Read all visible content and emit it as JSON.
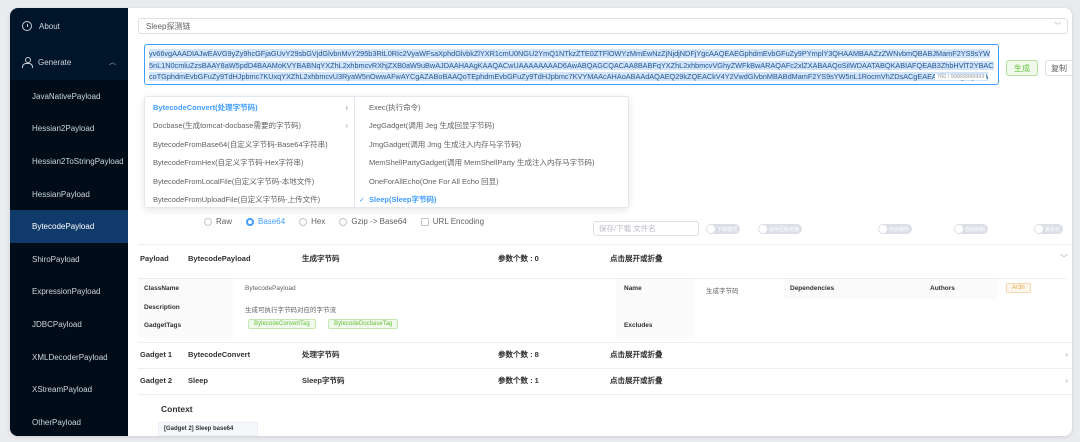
{
  "sidebar": {
    "about": "About",
    "generate": "Generate",
    "items": [
      {
        "label": "JavaNativePayload"
      },
      {
        "label": "Hessian2Payload"
      },
      {
        "label": "Hessian2ToStringPayload"
      },
      {
        "label": "HessianPayload"
      },
      {
        "label": "BytecodePayload"
      },
      {
        "label": "ShiroPayload"
      },
      {
        "label": "ExpressionPayload"
      },
      {
        "label": "JDBCPayload"
      },
      {
        "label": "XMLDecoderPayload"
      },
      {
        "label": "XStreamPayload"
      },
      {
        "label": "OtherPayload"
      }
    ]
  },
  "top_select": {
    "value": "Sleep探测链"
  },
  "payload": {
    "text": "yv66vgAAADIAJwEAVG9yZy9hcGFjaGUvY29sbGVjdGlvbnMvY295b3RtL0RIc2VyaWFsaXphdGlvbkZlYXR1cmU0NGU2YmQ1NTkzZTE0ZTFlOWYzMmEwNzZjNjdjNDFjYgcAAQEAEGphdmEvbGFuZy9PYmplY3QHAAMBAAZzZWNvbmQBABJMamF2YS9sYW5nL1N0cmluZzsBAAY8aW5pdD4BAAMoKVYBABNqYXZhL2xhbmcvRXhjZXB0aW9uBwAJDAAHAAgKAAQACwUAAAAAAAAD6AwABQAGCQACAA8BABFqYXZhL2xhbmcvVGhyZWFkBwARAQAFc2xlZXABAAQoSilWDAATABQKABIAFQEAB3ZhbHVlT2YBACcoTGphdmEvbGFuZy9TdHJpbmc7KUxqYXZhL2xhbmcvU3RyaW5nOwwAFwAYCgAZABoBAAQoTEphdmEvbGFuZy9TdHJpbmc7KVYMAAcAHAoABAAdAQAEQ29kZQEACkV4Y2VwdGlvbnMBABdMamF2YS9sYW5nL1RocmVhZDsACgEAEAAhAEAg6QCoAmF2YS9sYW5nL1RocmVhZDsACgAIABhAAg8Y2xpbml0PgEAATUIACK",
    "counter": "760 / 99999999999"
  },
  "buttons": {
    "generate": "生成",
    "copy": "复制"
  },
  "cascader": {
    "col1": [
      {
        "label": "BytecodeConvert(处理字节码)",
        "selected": true,
        "has_child": true
      },
      {
        "label": "Docbase(生成tomcat-docbase需要的字节码)",
        "selected": false,
        "has_child": true
      },
      {
        "label": "BytecodeFromBase64(自定义字节码-Base64字符串)",
        "selected": false,
        "has_child": false
      },
      {
        "label": "BytecodeFromHex(自定义字节码-Hex字符串)",
        "selected": false,
        "has_child": false
      },
      {
        "label": "BytecodeFromLocalFile(自定义字节码-本地文件)",
        "selected": false,
        "has_child": false
      },
      {
        "label": "BytecodeFromUploadFile(自定义字节码-上传文件)",
        "selected": false,
        "has_child": false
      }
    ],
    "col2": [
      {
        "label": "Exec(执行命令)",
        "selected": false
      },
      {
        "label": "JegGadget(调用 Jeg 生成回显字节码)",
        "selected": false
      },
      {
        "label": "JmgGadget(调用 Jmg 生成注入内存马字节码)",
        "selected": false
      },
      {
        "label": "MemShellPartyGadget(调用 MemShellParty 生成注入内存马字节码)",
        "selected": false
      },
      {
        "label": "OneForAllEcho(One For All Echo 回显)",
        "selected": false
      },
      {
        "label": "Sleep(Sleep字节码)",
        "selected": true
      }
    ]
  },
  "formats": {
    "raw": "Raw",
    "base64": "Base64",
    "hex": "Hex",
    "gzip": "Gzip -> Base64",
    "url": "URL Encoding",
    "selected": "Base64"
  },
  "save_input": {
    "placeholder": "保存/下载 文件名"
  },
  "toggles": [
    {
      "label": "下载模式"
    },
    {
      "label": "保存至服务器"
    },
    {
      "label": "开启缓存"
    },
    {
      "label": "自动刷新"
    },
    {
      "label": "复杂化"
    }
  ],
  "payload_row": {
    "type": "Payload",
    "name": "BytecodePayload",
    "desc": "生成字节码",
    "params": "参数个数 : 0",
    "toggle": "点击展开或折叠"
  },
  "details": {
    "classname_label": "ClassName",
    "classname_value": "BytecodePayload",
    "name_label": "Name",
    "name_value": "生成字节码",
    "deps_label": "Dependencies",
    "authors_label": "Authors",
    "author": "Ar3h",
    "description_label": "Description",
    "description_value": "生成可执行字节码对应的字节流",
    "gadgettags_label": "GadgetTags",
    "tags": [
      "BytecodeConvertTag",
      "BytecodeDocbaseTag"
    ],
    "excludes_label": "Excludes"
  },
  "gadgets": [
    {
      "type": "Gadget 1",
      "name": "BytecodeConvert",
      "desc": "处理字节码",
      "params": "参数个数 : 8",
      "toggle": "点击展开或折叠"
    },
    {
      "type": "Gadget 2",
      "name": "Sleep",
      "desc": "Sleep字节码",
      "params": "参数个数 : 1",
      "toggle": "点击展开或折叠"
    }
  ],
  "context": {
    "title": "Context",
    "cell": "[Gadget 2] Sleep base64"
  },
  "colors": {
    "sidebar": "#001529",
    "active": "#0f3a6a",
    "primary": "#409eff",
    "success": "#67c23a"
  }
}
